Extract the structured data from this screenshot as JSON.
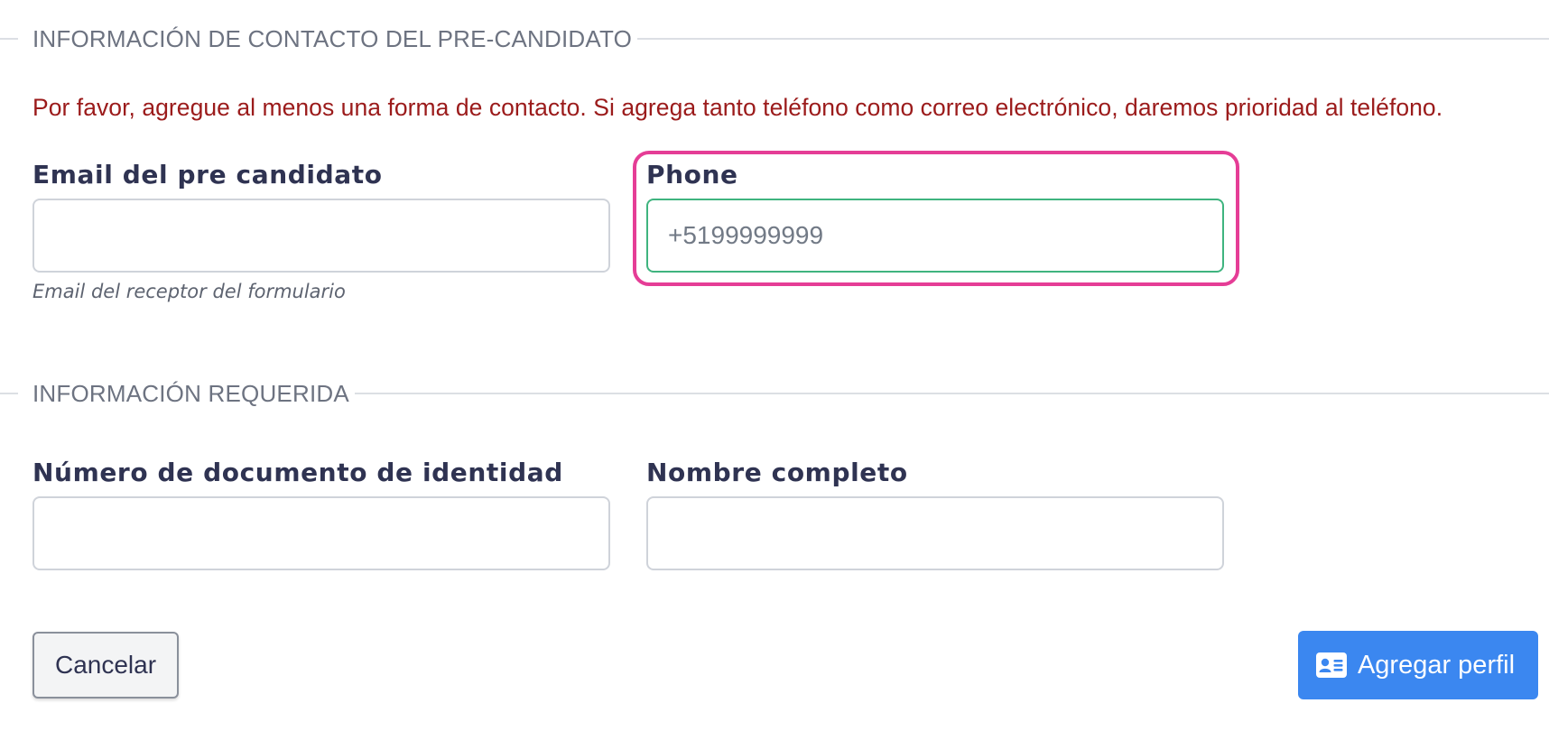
{
  "sections": {
    "contact": {
      "title": "INFORMACIÓN DE CONTACTO DEL PRE-CANDIDATO"
    },
    "required": {
      "title": "INFORMACIÓN REQUERIDA"
    }
  },
  "notice": "Por favor, agregue al menos una forma de contacto. Si agrega tanto teléfono como correo electrónico, daremos prioridad al teléfono.",
  "fields": {
    "email": {
      "label": "Email del pre candidato",
      "value": "",
      "hint": "Email del receptor del formulario"
    },
    "phone": {
      "label": "Phone",
      "value": "",
      "placeholder": "+5199999999"
    },
    "document": {
      "label": "Número de documento de identidad",
      "value": ""
    },
    "full_name": {
      "label": "Nombre completo",
      "value": ""
    }
  },
  "buttons": {
    "cancel": "Cancelar",
    "submit": "Agregar perfil",
    "submit_icon": "id-card-icon"
  },
  "colors": {
    "notice": "#9b1b1b",
    "focus_border": "#3fb47f",
    "highlight": "#e53d96",
    "primary": "#3b87f0"
  }
}
